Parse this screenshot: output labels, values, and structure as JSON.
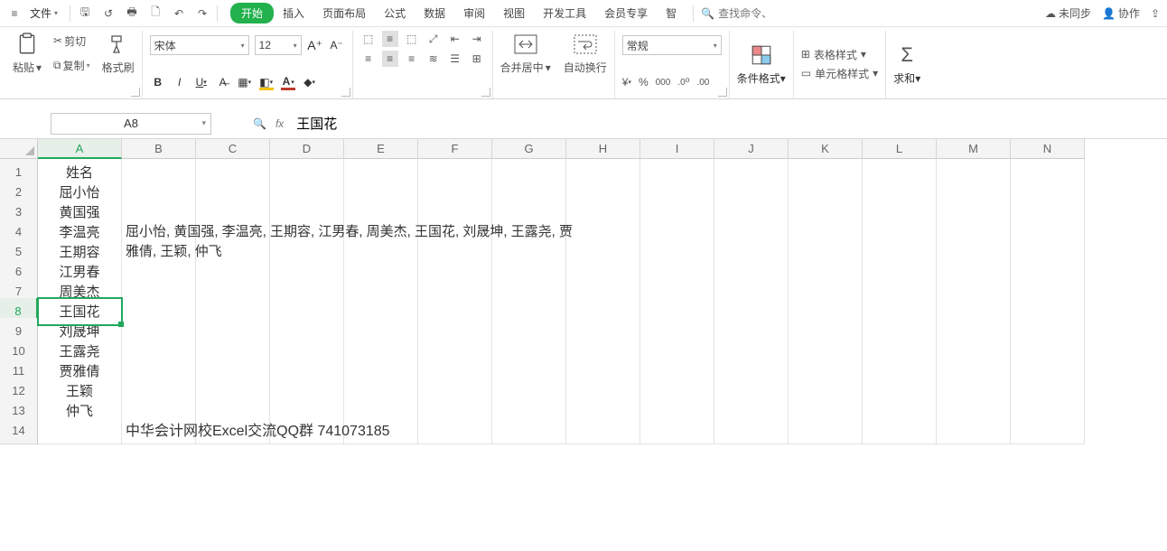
{
  "menu": {
    "file": "文件",
    "tabs": [
      "开始",
      "插入",
      "页面布局",
      "公式",
      "数据",
      "审阅",
      "视图",
      "开发工具",
      "会员专享",
      "智"
    ],
    "active_tab_index": 0,
    "search_placeholder": "查找命令、",
    "unsync": "未同步",
    "collab": "协作"
  },
  "ribbon": {
    "clipboard": {
      "paste": "粘贴",
      "cut": "剪切",
      "copy": "复制",
      "brush": "格式刷"
    },
    "font": {
      "name": "宋体",
      "size": "12"
    },
    "merge": "合并居中",
    "wrap": "自动换行",
    "numfmt": {
      "general": "常规"
    },
    "cond": "条件格式",
    "table_style": "表格样式",
    "cell_style": "单元格样式",
    "sum": "求和"
  },
  "fx": {
    "namebox": "A8",
    "formula": "王国花"
  },
  "grid": {
    "cols": [
      "A",
      "B",
      "C",
      "D",
      "E",
      "F",
      "G",
      "H",
      "I",
      "J",
      "K",
      "L",
      "M",
      "N"
    ],
    "selected_col_index": 0,
    "selected_row_index": 7,
    "rows": {
      "1": "姓名",
      "2": "屈小怡",
      "3": "黄国强",
      "4": "李温亮",
      "5": "王期容",
      "6": "江男春",
      "7": "周美杰",
      "8": "王国花",
      "9": "刘晟坤",
      "10": "王露尧",
      "11": "贾雅倩",
      "12": "王颖",
      "13": "仲飞"
    },
    "b4_overflow": "屈小怡, 黄国强, 李温亮, 王期容, 江男春, 周美杰, 王国花, 刘晟坤, 王露尧, 贾雅倩, 王颖, 仲飞",
    "footer": "中华会计网校Excel交流QQ群  741073185"
  }
}
